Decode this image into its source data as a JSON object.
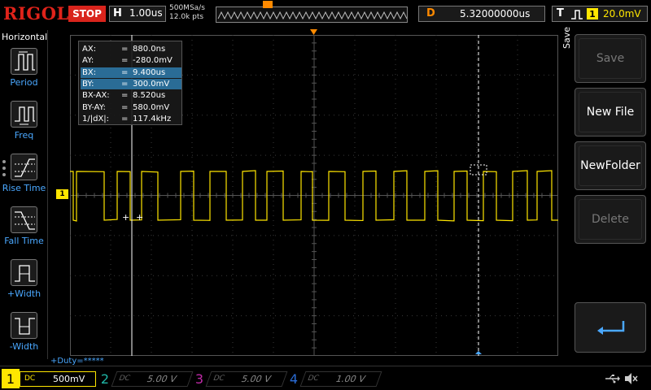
{
  "topbar": {
    "logo": "RIGOL",
    "run_state": "STOP",
    "horizontal_letter": "H",
    "timebase": "1.00us",
    "sample_rate": "500MSa/s",
    "memory_depth": "12.0k pts",
    "delay_letter": "D",
    "delay_value": "5.32000000us",
    "trigger_letter": "T",
    "trigger_source": "1",
    "trigger_level": "20.0mV"
  },
  "left_menu": {
    "title": "Horizontal",
    "items": [
      {
        "label": "Period",
        "icon": "period-icon"
      },
      {
        "label": "Freq",
        "icon": "freq-icon"
      },
      {
        "label": "Rise Time",
        "icon": "rise-time-icon"
      },
      {
        "label": "Fall Time",
        "icon": "fall-time-icon"
      },
      {
        "label": "+Width",
        "icon": "pos-width-icon"
      },
      {
        "label": "-Width",
        "icon": "neg-width-icon"
      }
    ]
  },
  "cursor_table": {
    "rows": [
      {
        "name": "AX:",
        "eq": "=",
        "value": "880.0ns",
        "highlight": false
      },
      {
        "name": "AY:",
        "eq": "=",
        "value": "-280.0mV",
        "highlight": false
      },
      {
        "name": "BX:",
        "eq": "=",
        "value": "9.400us",
        "highlight": true
      },
      {
        "name": "BY:",
        "eq": "=",
        "value": "300.0mV",
        "highlight": true
      },
      {
        "name": "BX-AX:",
        "eq": "=",
        "value": "8.520us",
        "highlight": false
      },
      {
        "name": "BY-AY:",
        "eq": "=",
        "value": "580.0mV",
        "highlight": false
      },
      {
        "name": "1/|dX|:",
        "eq": "=",
        "value": "117.4kHz",
        "highlight": false
      }
    ]
  },
  "channel_markers": {
    "ch1": "1",
    "trigger": "T"
  },
  "duty_label": "+Duty=*****",
  "right_menu": {
    "title": "Save",
    "buttons": [
      {
        "label": "Save",
        "enabled": false
      },
      {
        "label": "New File",
        "enabled": true
      },
      {
        "label": "NewFolder",
        "enabled": true
      },
      {
        "label": "Delete",
        "enabled": false
      }
    ]
  },
  "channels": [
    {
      "num": "1",
      "coupling": "DC",
      "scale": "500mV",
      "color": "#ffe600",
      "active": true
    },
    {
      "num": "2",
      "coupling": "DC",
      "scale": "5.00 V",
      "color": "#1fb6a6",
      "active": false
    },
    {
      "num": "3",
      "coupling": "DC",
      "scale": "5.00 V",
      "color": "#c02aa8",
      "active": false
    },
    {
      "num": "4",
      "coupling": "DC",
      "scale": "1.00 V",
      "color": "#2a6cd6",
      "active": false
    }
  ],
  "colors": {
    "ch1": "#ffe600",
    "trigger": "#ff8a00",
    "accent": "#4aa8ff",
    "brand": "#e0231a"
  },
  "icons": {
    "usb": "usb-icon",
    "sound": "speaker-muted-icon",
    "enter": "enter-icon"
  }
}
